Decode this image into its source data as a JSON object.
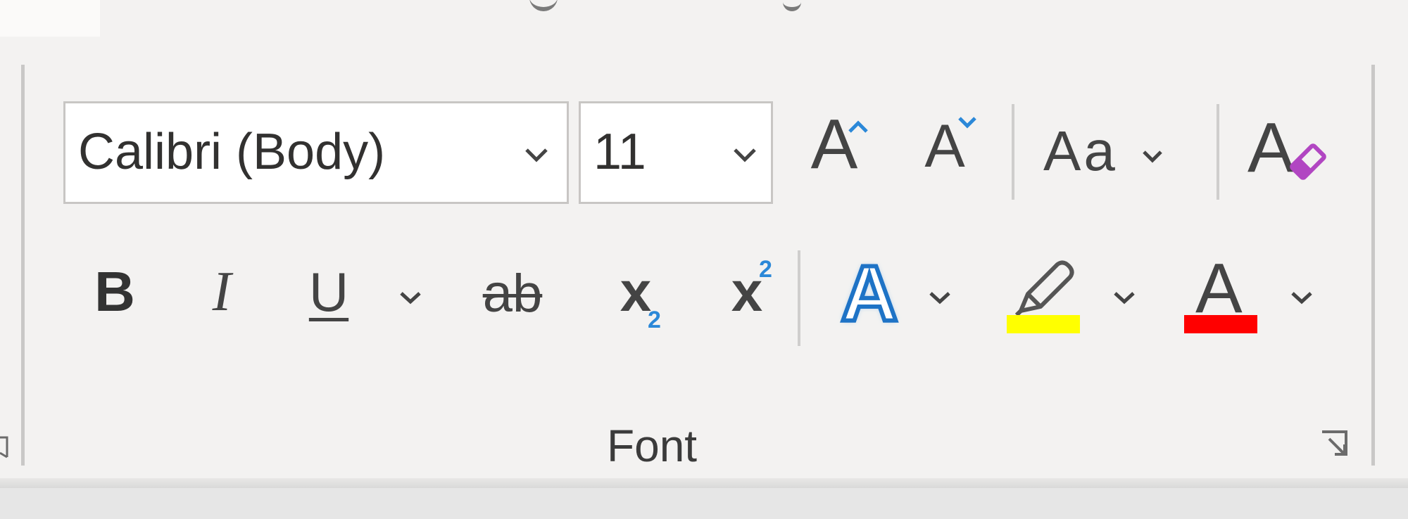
{
  "group": {
    "label": "Font"
  },
  "font_name": {
    "value": "Calibri (Body)"
  },
  "font_size": {
    "value": "11"
  },
  "buttons": {
    "grow_font": {
      "glyph": "A"
    },
    "shrink_font": {
      "glyph": "A"
    },
    "change_case": {
      "glyph": "Aa"
    },
    "clear_formatting": {
      "glyph": "A"
    },
    "bold": {
      "glyph": "B"
    },
    "italic": {
      "glyph": "I"
    },
    "underline": {
      "glyph": "U"
    },
    "strikethrough": {
      "glyph": "ab"
    },
    "subscript": {
      "glyph": "x",
      "mark": "2"
    },
    "superscript": {
      "glyph": "x",
      "mark": "2"
    },
    "text_effects": {
      "glyph": "A"
    },
    "font_color": {
      "glyph": "A"
    }
  },
  "colors": {
    "highlight": "#ffff00",
    "font_color": "#ff0000",
    "accent_blue": "#2b88d8",
    "eraser_purple": "#b146c2"
  }
}
